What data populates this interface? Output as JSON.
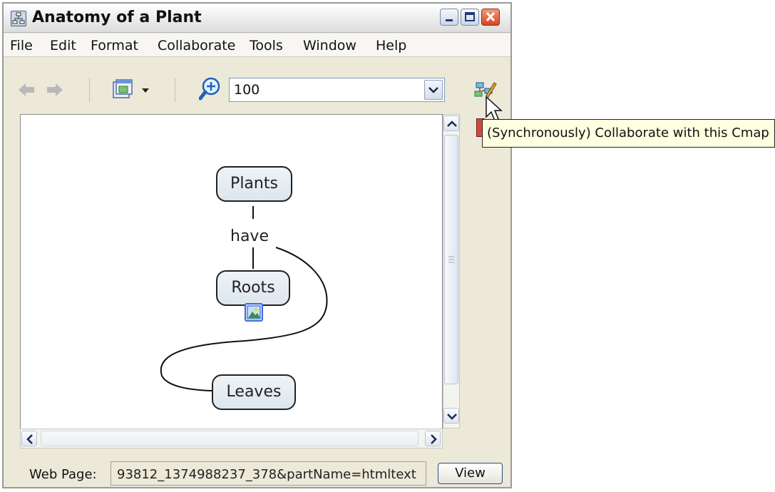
{
  "window": {
    "title": "Anatomy of a Plant",
    "app_icon": "concept-map-icon"
  },
  "menu": [
    "File",
    "Edit",
    "Format",
    "Collaborate",
    "Tools",
    "Window",
    "Help"
  ],
  "toolbar": {
    "back_icon": "back-arrow-icon",
    "forward_icon": "forward-arrow-icon",
    "view_icon": "window-view-icon",
    "zoom_icon": "zoom-icon",
    "zoom_value": "100",
    "collaborate_icon": "collaborate-icon"
  },
  "concept_map": {
    "nodes": [
      "Plants",
      "Roots",
      "Leaves"
    ],
    "linking_phrase": "have",
    "resource_icon": "image-resource-icon"
  },
  "tooltip": "(Synchronously) Collaborate with this Cmap",
  "status": {
    "label": "Web Page:",
    "url": "93812_1374988237_378&partName=htmltext",
    "view_button": "View"
  },
  "colors": {
    "node_fill": "#e3ebf2",
    "window_bg": "#ece9d8",
    "tooltip_bg": "#ffffe1",
    "close_button": "#d2471e"
  }
}
